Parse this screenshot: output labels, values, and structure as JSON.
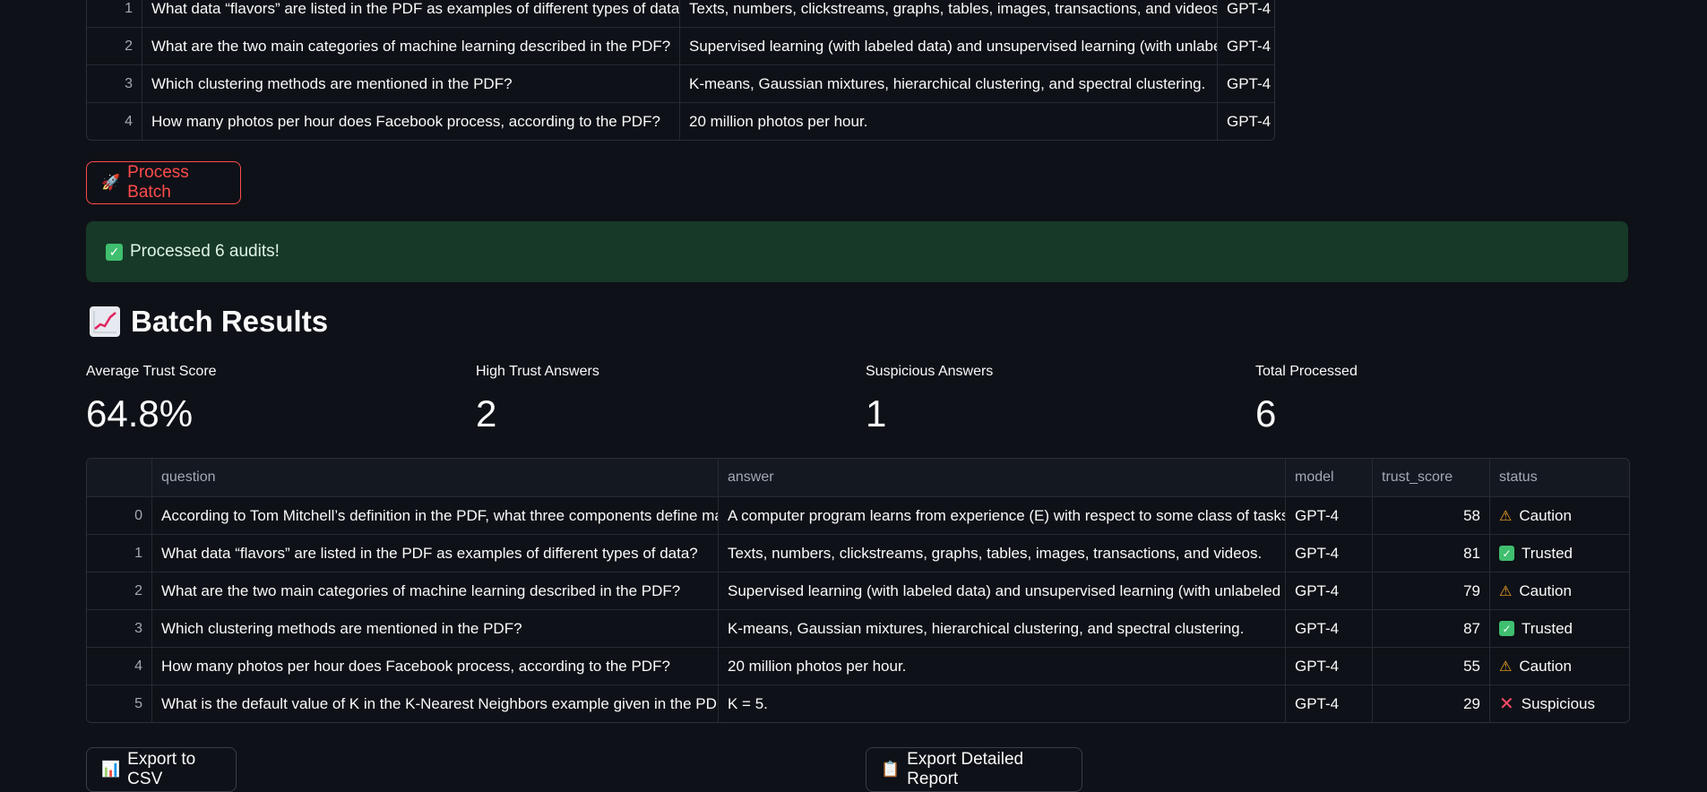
{
  "top_table": {
    "rows": [
      {
        "idx": "1",
        "question": "What data “flavors” are listed in the PDF as examples of different types of data?",
        "answer": "Texts, numbers, clickstreams, graphs, tables, images, transactions, and videos.",
        "model": "GPT-4"
      },
      {
        "idx": "2",
        "question": "What are the two main categories of machine learning described in the PDF?",
        "answer": "Supervised learning (with labeled data) and unsupervised learning (with unlabeled data).",
        "model": "GPT-4"
      },
      {
        "idx": "3",
        "question": "Which clustering methods are mentioned in the PDF?",
        "answer": "K-means, Gaussian mixtures, hierarchical clustering, and spectral clustering.",
        "model": "GPT-4"
      },
      {
        "idx": "4",
        "question": "How many photos per hour does Facebook process, according to the PDF?",
        "answer": "20 million photos per hour.",
        "model": "GPT-4"
      }
    ]
  },
  "process_button": {
    "icon": "rocket-icon",
    "label": "Process Batch"
  },
  "success": {
    "icon": "check-icon",
    "text": "Processed 6 audits!"
  },
  "results": {
    "icon": "chart-increasing-icon",
    "title": "Batch Results",
    "metrics": [
      {
        "label": "Average Trust Score",
        "value": "64.8%"
      },
      {
        "label": "High Trust Answers",
        "value": "2"
      },
      {
        "label": "Suspicious Answers",
        "value": "1"
      },
      {
        "label": "Total Processed",
        "value": "6"
      }
    ],
    "columns": [
      "question",
      "answer",
      "model",
      "trust_score",
      "status"
    ],
    "rows": [
      {
        "idx": "0",
        "question": "According to Tom Mitchell’s definition in the PDF, what three components define machine learning?",
        "answer": "A computer program learns from experience (E) with respect to some class of tasks (T) and performance measure (P).",
        "model": "GPT-4",
        "trust_score": "58",
        "status": "Caution",
        "status_icon": "warning-icon"
      },
      {
        "idx": "1",
        "question": "What data “flavors” are listed in the PDF as examples of different types of data?",
        "answer": "Texts, numbers, clickstreams, graphs, tables, images, transactions, and videos.",
        "model": "GPT-4",
        "trust_score": "81",
        "status": "Trusted",
        "status_icon": "check-icon"
      },
      {
        "idx": "2",
        "question": "What are the two main categories of machine learning described in the PDF?",
        "answer": "Supervised learning (with labeled data) and unsupervised learning (with unlabeled data).",
        "model": "GPT-4",
        "trust_score": "79",
        "status": "Caution",
        "status_icon": "warning-icon"
      },
      {
        "idx": "3",
        "question": "Which clustering methods are mentioned in the PDF?",
        "answer": "K-means, Gaussian mixtures, hierarchical clustering, and spectral clustering.",
        "model": "GPT-4",
        "trust_score": "87",
        "status": "Trusted",
        "status_icon": "check-icon"
      },
      {
        "idx": "4",
        "question": "How many photos per hour does Facebook process, according to the PDF?",
        "answer": "20 million photos per hour.",
        "model": "GPT-4",
        "trust_score": "55",
        "status": "Caution",
        "status_icon": "warning-icon"
      },
      {
        "idx": "5",
        "question": "What is the default value of K in the K-Nearest Neighbors example given in the PDF?",
        "answer": "K = 5.",
        "model": "GPT-4",
        "trust_score": "29",
        "status": "Suspicious",
        "status_icon": "cross-icon"
      }
    ]
  },
  "export_csv": {
    "icon": "bar-chart-icon",
    "label": "Export to CSV"
  },
  "export_report": {
    "icon": "clipboard-icon",
    "label": "Export Detailed Report"
  },
  "colors": {
    "background": "#0e1117",
    "accent": "#ff4b4b",
    "success_bg": "#173928",
    "trusted": "#3fbf6f",
    "caution": "#f5a524",
    "suspicious": "#ff4b6b"
  }
}
